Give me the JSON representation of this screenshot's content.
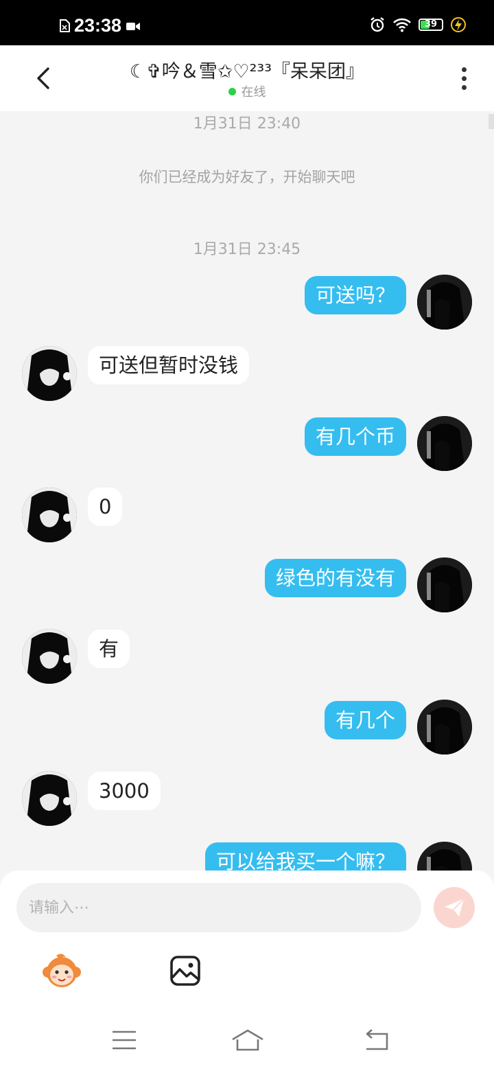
{
  "status_bar": {
    "time": "23:38",
    "battery": "39"
  },
  "header": {
    "title": "☾✞吟＆雪✩♡²³³『呆呆团』",
    "presence": "在线"
  },
  "chat": {
    "timestamps": [
      "1月31日 23:40",
      "1月31日 23:45"
    ],
    "system_message": "你们已经成为好友了，开始聊天吧",
    "messages": [
      {
        "side": "out",
        "text": "可送吗？"
      },
      {
        "side": "in",
        "text": "可送但暂时没钱"
      },
      {
        "side": "out",
        "text": "有几个币"
      },
      {
        "side": "in",
        "text": "0"
      },
      {
        "side": "out",
        "text": "绿色的有没有"
      },
      {
        "side": "in",
        "text": "有"
      },
      {
        "side": "out",
        "text": "有几个"
      },
      {
        "side": "in",
        "text": "3000"
      },
      {
        "side": "out",
        "text": "可以给我买一个嘛？"
      }
    ]
  },
  "composer": {
    "placeholder": "请输入⋯"
  },
  "colors": {
    "outgoing_bubble": "#35bdf0",
    "incoming_bubble": "#ffffff",
    "online_dot": "#2bd146",
    "send_button": "#fbd6d0"
  },
  "icons": [
    "back-arrow-icon",
    "more-vertical-icon",
    "send-icon",
    "monkey-emoji-icon",
    "image-icon",
    "menu-icon",
    "home-icon",
    "return-icon"
  ]
}
